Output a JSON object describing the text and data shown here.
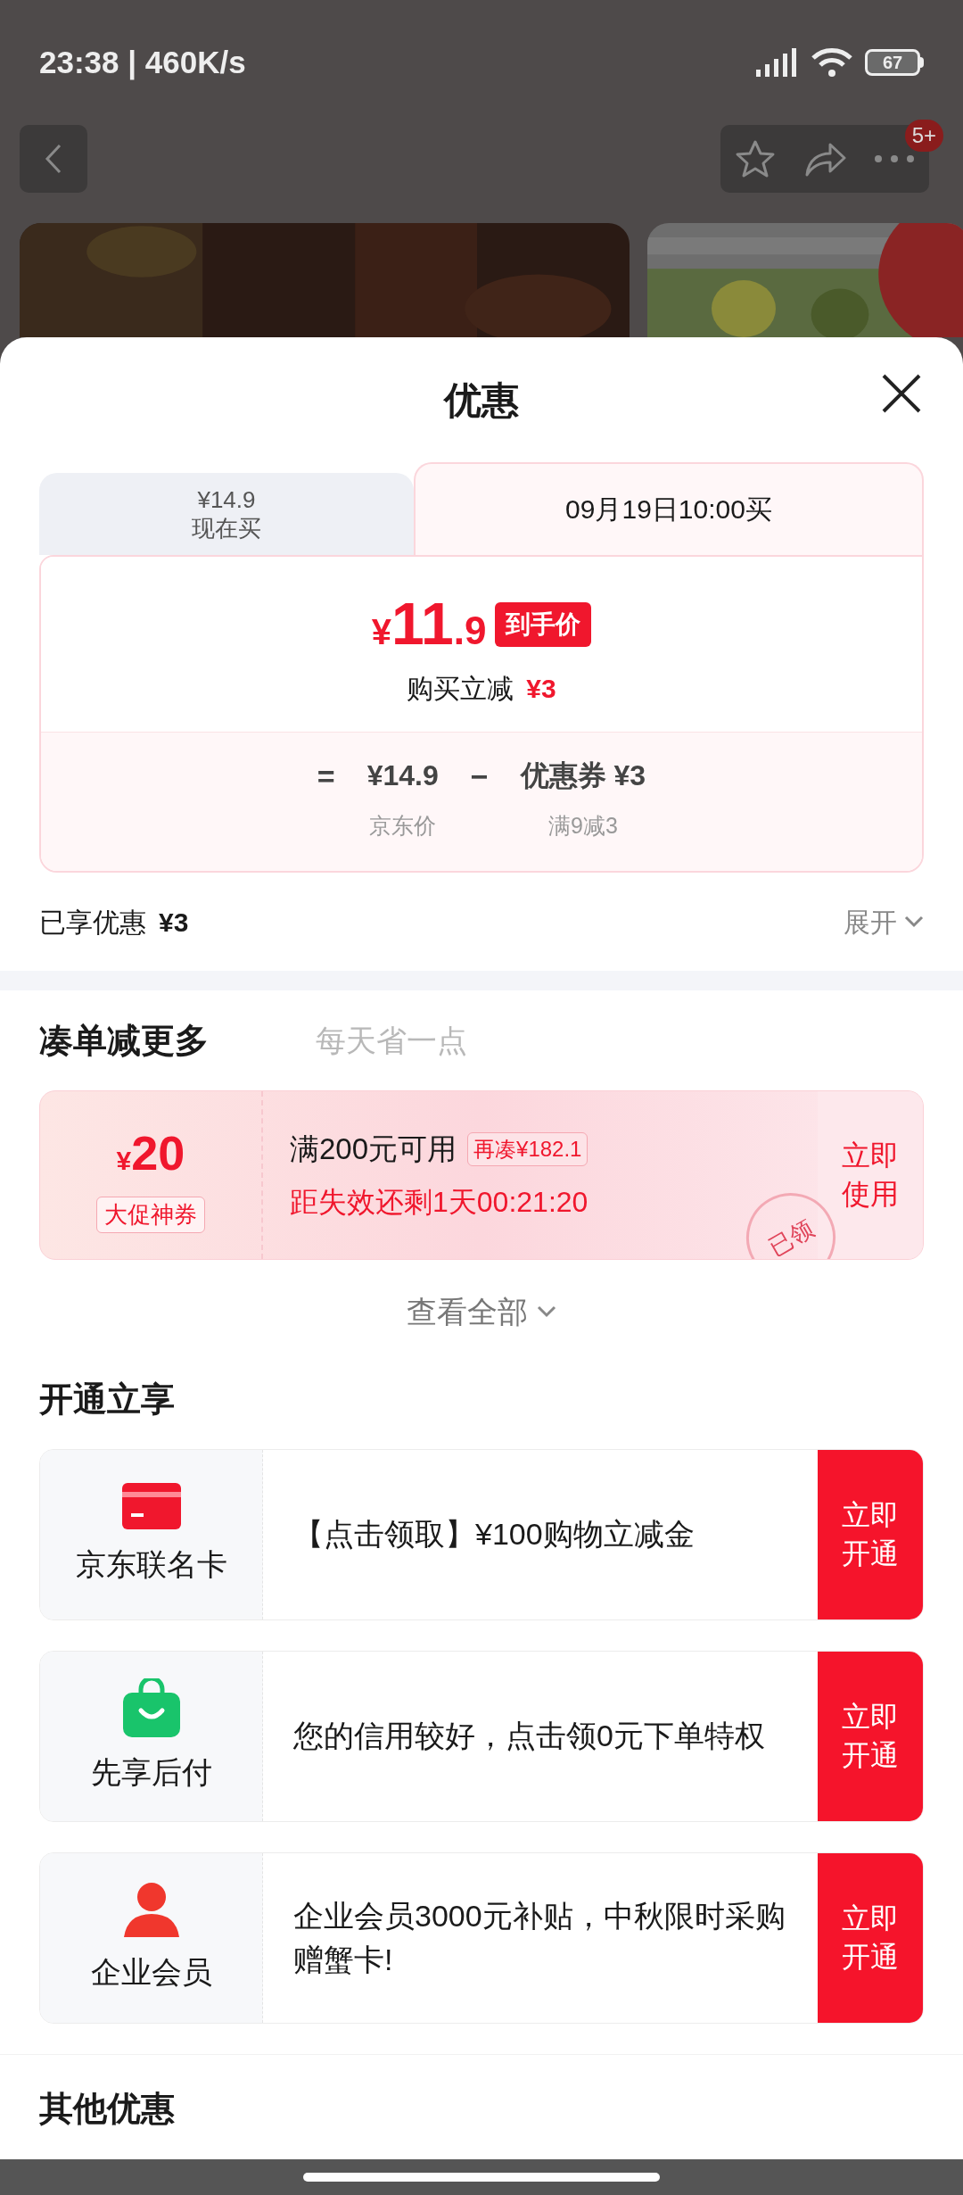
{
  "status_bar": {
    "time": "23:38 | 460K/s",
    "battery": "67"
  },
  "nav": {
    "badge": "5+"
  },
  "sheet": {
    "title": "优惠"
  },
  "price_tabs": [
    {
      "lines": [
        "¥14.9",
        "现在买"
      ],
      "selected": false
    },
    {
      "lines": [
        "09月19日10:00买"
      ],
      "selected": true
    }
  ],
  "final_price": {
    "currency": "¥",
    "integer": "11",
    "decimal": ".9",
    "tag": "到手价"
  },
  "instant_cut": {
    "label": "购买立减",
    "amount": "¥3"
  },
  "formula": [
    {
      "kind": "operator",
      "text": "="
    },
    {
      "kind": "term",
      "value": "¥14.9",
      "caption": "京东价"
    },
    {
      "kind": "operator",
      "text": "−"
    },
    {
      "kind": "term",
      "value": "优惠券 ¥3",
      "caption": "满9减3"
    }
  ],
  "enjoyed": {
    "label": "已享优惠",
    "amount": "¥3"
  },
  "expand": {
    "label": "展开",
    "expanded": false
  },
  "bundle": {
    "title": "凑单减更多",
    "slogan": "每天省一点"
  },
  "coupon": {
    "currency": "¥",
    "amount": "20",
    "tag": "大促神券",
    "condition": "满200元可用",
    "gap": "再凑¥182.1",
    "countdown": "距失效还剩1天00:21:20",
    "stamp": "已领",
    "action": "立即使用"
  },
  "view_all": "查看全部",
  "open_section": {
    "title": "开通立享",
    "items": [
      {
        "kind": "card",
        "name": "京东联名卡",
        "text": "【点击领取】¥100购物立减金",
        "action": "立即开通"
      },
      {
        "kind": "bag",
        "name": "先享后付",
        "text": "您的信用较好，点击领0元下单特权",
        "action": "立即开通"
      },
      {
        "kind": "person",
        "name": "企业会员",
        "text": "企业会员3000元补贴，中秋限时采购赠蟹卡!",
        "action": "立即开通"
      }
    ]
  },
  "other": {
    "title": "其他优惠"
  }
}
